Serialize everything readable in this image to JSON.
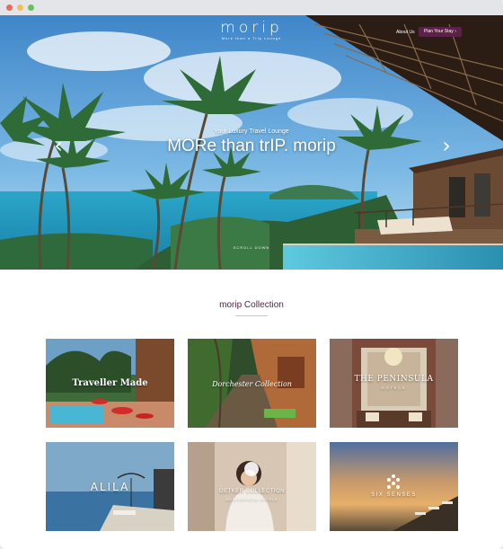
{
  "header": {
    "logo": "morip",
    "logo_sub": "More than a Trip Lounge",
    "nav": {
      "about_label": "About Us",
      "cta_label": "Plan Your Stay"
    }
  },
  "hero": {
    "tagline": "Your Luxury Travel Lounge",
    "headline": "MORe than trIP. morip",
    "scroll_hint": "SCROLL DOWN"
  },
  "collection": {
    "title": "morip Collection",
    "cards": [
      {
        "label": "Traveller Made"
      },
      {
        "label": "Dorchester Collection"
      },
      {
        "label": "THE PENINSULA",
        "sub": "HOTELS"
      },
      {
        "label": "ALILA"
      },
      {
        "label": "OETKER COLLECTION",
        "sub": "MASTERPIECE HOTELS"
      },
      {
        "label": "SIX SENSES"
      }
    ]
  },
  "colors": {
    "brand": "#5a2247",
    "chrome": "#e3e5e8"
  },
  "icons": [
    "left-arrow-icon",
    "right-arrow-icon"
  ]
}
